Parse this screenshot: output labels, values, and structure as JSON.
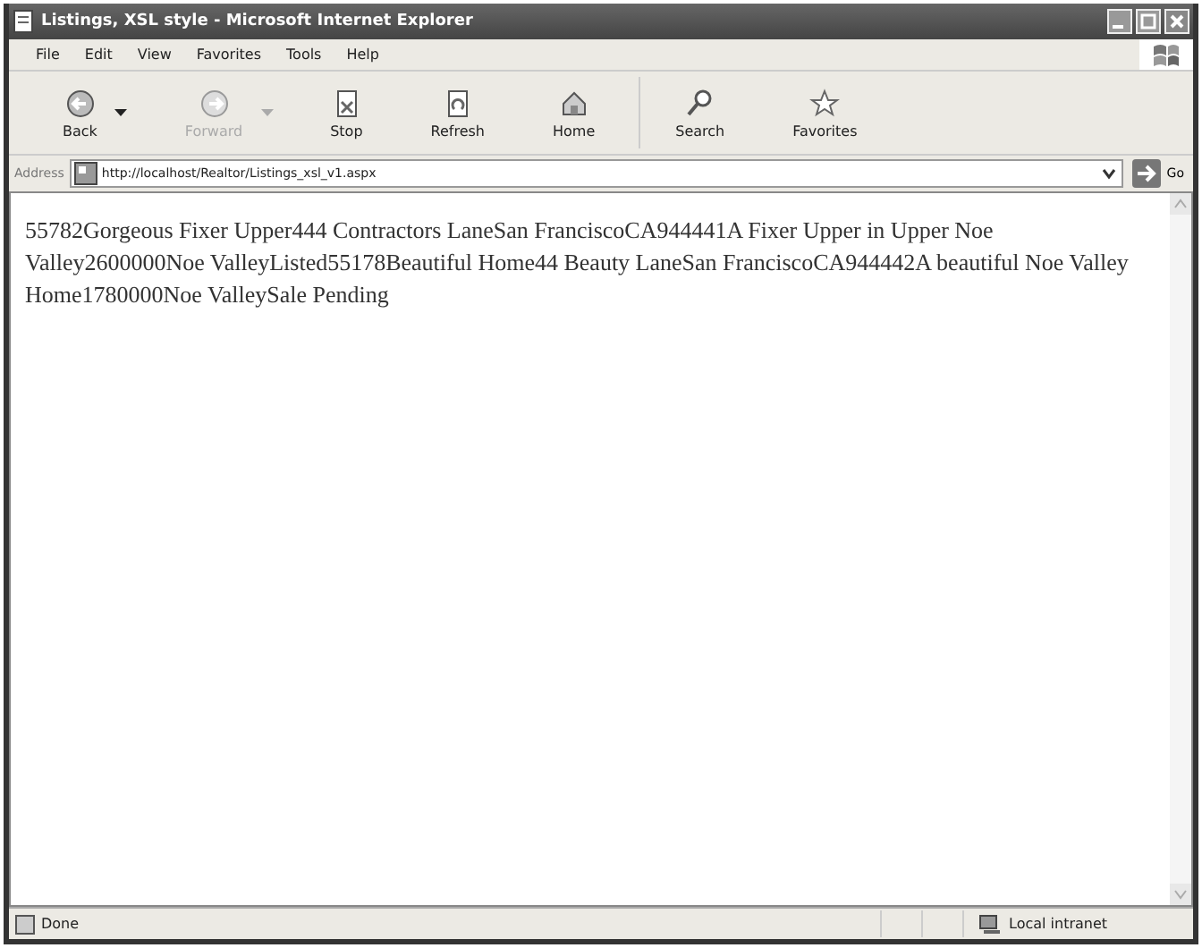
{
  "window": {
    "title": "Listings, XSL style - Microsoft Internet Explorer"
  },
  "menu": [
    "File",
    "Edit",
    "View",
    "Favorites",
    "Tools",
    "Help"
  ],
  "toolbar": [
    {
      "label": "Back",
      "kind": "back",
      "disabled": false,
      "dropdown": true
    },
    {
      "label": "Forward",
      "kind": "forward",
      "disabled": true,
      "dropdown": true
    },
    {
      "label": "Stop",
      "kind": "stop",
      "disabled": false,
      "dropdown": false
    },
    {
      "label": "Refresh",
      "kind": "refresh",
      "disabled": false,
      "dropdown": false
    },
    {
      "label": "Home",
      "kind": "home",
      "disabled": false,
      "dropdown": false
    },
    {
      "label": "Search",
      "kind": "search",
      "disabled": false,
      "dropdown": false
    },
    {
      "label": "Favorites",
      "kind": "favorites",
      "disabled": false,
      "dropdown": false
    }
  ],
  "address": {
    "label": "Address",
    "value": "http://localhost/Realtor/Listings_xsl_v1.aspx",
    "go": "Go"
  },
  "content": {
    "text": "55782Gorgeous Fixer Upper444 Contractors LaneSan FranciscoCA944441A Fixer Upper in Upper Noe Valley2600000Noe ValleyListed55178Beautiful Home44 Beauty LaneSan FranciscoCA944442A beautiful Noe Valley Home1780000Noe ValleySale Pending"
  },
  "status_bar": {
    "status": "Done",
    "zone": "Local intranet"
  }
}
